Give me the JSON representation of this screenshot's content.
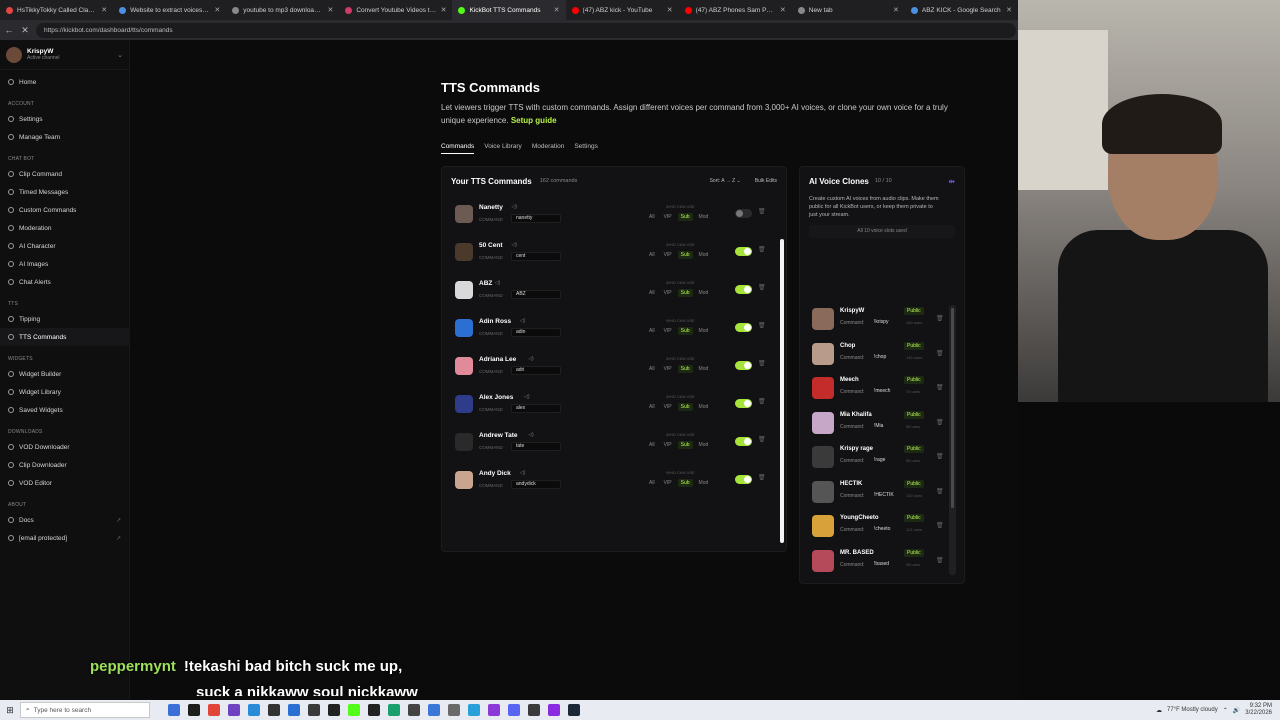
{
  "browser": {
    "tabs": [
      {
        "title": "HsTikkyTokky Called Clavicular",
        "color": "#e04646",
        "active": false
      },
      {
        "title": "Website to extract voices from",
        "color": "#4a90e2",
        "active": false
      },
      {
        "title": "youtube to mp3 downloader - G",
        "color": "#888888",
        "active": false
      },
      {
        "title": "Convert Youtube Videos to MP3",
        "color": "#d13b6a",
        "active": false
      },
      {
        "title": "KickBot TTS Commands",
        "color": "#53fc18",
        "active": true
      },
      {
        "title": "(47) ABZ kick - YouTube",
        "color": "#ff0000",
        "active": false
      },
      {
        "title": "(47) ABZ Phones Sam Pepper &",
        "color": "#ff0000",
        "active": false
      },
      {
        "title": "New tab",
        "color": "#888888",
        "active": false
      },
      {
        "title": "ABZ KICK - Google Search",
        "color": "#4a90e2",
        "active": false
      }
    ],
    "url": "https://kickbot.com/dashboard/tts/commands"
  },
  "sidebar": {
    "channel_name": "KrispyW",
    "channel_status": "Active channel",
    "home": "Home",
    "sections": [
      {
        "label": "ACCOUNT",
        "items": [
          {
            "label": "Settings"
          },
          {
            "label": "Manage Team"
          }
        ]
      },
      {
        "label": "CHAT BOT",
        "items": [
          {
            "label": "Clip Command"
          },
          {
            "label": "Timed Messages"
          },
          {
            "label": "Custom Commands"
          },
          {
            "label": "Moderation"
          },
          {
            "label": "AI Character"
          },
          {
            "label": "AI Images"
          },
          {
            "label": "Chat Alerts"
          }
        ]
      },
      {
        "label": "TTS",
        "items": [
          {
            "label": "Tipping"
          },
          {
            "label": "TTS Commands",
            "active": true
          }
        ]
      },
      {
        "label": "WIDGETS",
        "items": [
          {
            "label": "Widget Builder"
          },
          {
            "label": "Widget Library"
          },
          {
            "label": "Saved Widgets"
          }
        ]
      },
      {
        "label": "DOWNLOADS",
        "items": [
          {
            "label": "VOD Downloader"
          },
          {
            "label": "Clip Downloader"
          },
          {
            "label": "VOD Editor"
          }
        ]
      },
      {
        "label": "ABOUT",
        "items": [
          {
            "label": "Docs",
            "ext": true
          },
          {
            "label": "[email protected]",
            "ext": true
          }
        ]
      }
    ]
  },
  "page": {
    "title": "TTS Commands",
    "description": "Let viewers trigger TTS with custom commands. Assign different voices per command from 3,000+ AI voices, or clone your own voice for a truly unique experience.",
    "setup_link": "Setup guide",
    "tabs": [
      "Commands",
      "Voice Library",
      "Moderation",
      "Settings"
    ]
  },
  "commands_panel": {
    "title": "Your TTS Commands",
    "count": "162 commands",
    "sort": "Sort: A → Z",
    "bulk": "Bulk Edits",
    "command_label": "COMMAND",
    "who_label": "WHO CAN USE",
    "perms": [
      "All",
      "VIP",
      "Sub",
      "Mod"
    ],
    "rows": [
      {
        "name": "Nanetty",
        "command": "nanetty",
        "enabled": false,
        "color": "#6b5b52"
      },
      {
        "name": "50 Cent",
        "command": "cent",
        "enabled": true,
        "color": "#4b3a2c"
      },
      {
        "name": "ABZ",
        "command": "ABZ",
        "enabled": true,
        "color": "#d9d9d9"
      },
      {
        "name": "Adin Ross",
        "command": "adin",
        "enabled": true,
        "color": "#2a6fd1"
      },
      {
        "name": "Adriana Lee",
        "command": "adri",
        "enabled": true,
        "color": "#e08a9a"
      },
      {
        "name": "Alex Jones",
        "command": "alex",
        "enabled": true,
        "color": "#2e3c8a"
      },
      {
        "name": "Andrew Tate",
        "command": "tate",
        "enabled": true,
        "color": "#2a2a2a"
      },
      {
        "name": "Andy Dick",
        "command": "andydick",
        "enabled": true,
        "color": "#c9a48f"
      }
    ]
  },
  "ai_panel": {
    "title": "AI Voice Clones",
    "count": "10 / 10",
    "description": "Create custom AI voices from audio clips. Make them public for all KickBot users, or keep them private to just your stream.",
    "slots": "All 10 voice slots used",
    "command_label": "Command:",
    "public_label": "Public",
    "clones": [
      {
        "name": "KrispyW",
        "command": "!krispy",
        "uses": "160 uses",
        "color": "#8a6a5a"
      },
      {
        "name": "Chop",
        "command": "!chop",
        "uses": "145 uses",
        "color": "#b89b8b"
      },
      {
        "name": "Meech",
        "command": "!meech",
        "uses": "76 uses",
        "color": "#c42b2b"
      },
      {
        "name": "Mia Khalifa",
        "command": "!Mia",
        "uses": "56 uses",
        "color": "#c7a7c7"
      },
      {
        "name": "Krispy rage",
        "command": "!rage",
        "uses": "56 uses",
        "color": "#3a3a3a"
      },
      {
        "name": "HECTIK",
        "command": "!HECTIK",
        "uses": "130 uses",
        "color": "#555555"
      },
      {
        "name": "YoungCheeto",
        "command": "!cheeto",
        "uses": "112 uses",
        "color": "#d8a13a"
      },
      {
        "name": "MR. BASED",
        "command": "!based",
        "uses": "98 uses",
        "color": "#b44a5a"
      }
    ]
  },
  "caption": {
    "user": "peppermynt",
    "line1": "!tekashi bad bitch suck me up,",
    "line2": "suck a nikkaww soul nickkaww"
  },
  "taskbar": {
    "search_placeholder": "Type here to search",
    "weather": "77°F  Mostly cloudy",
    "time": "9:32 PM",
    "date": "3/22/2026"
  }
}
